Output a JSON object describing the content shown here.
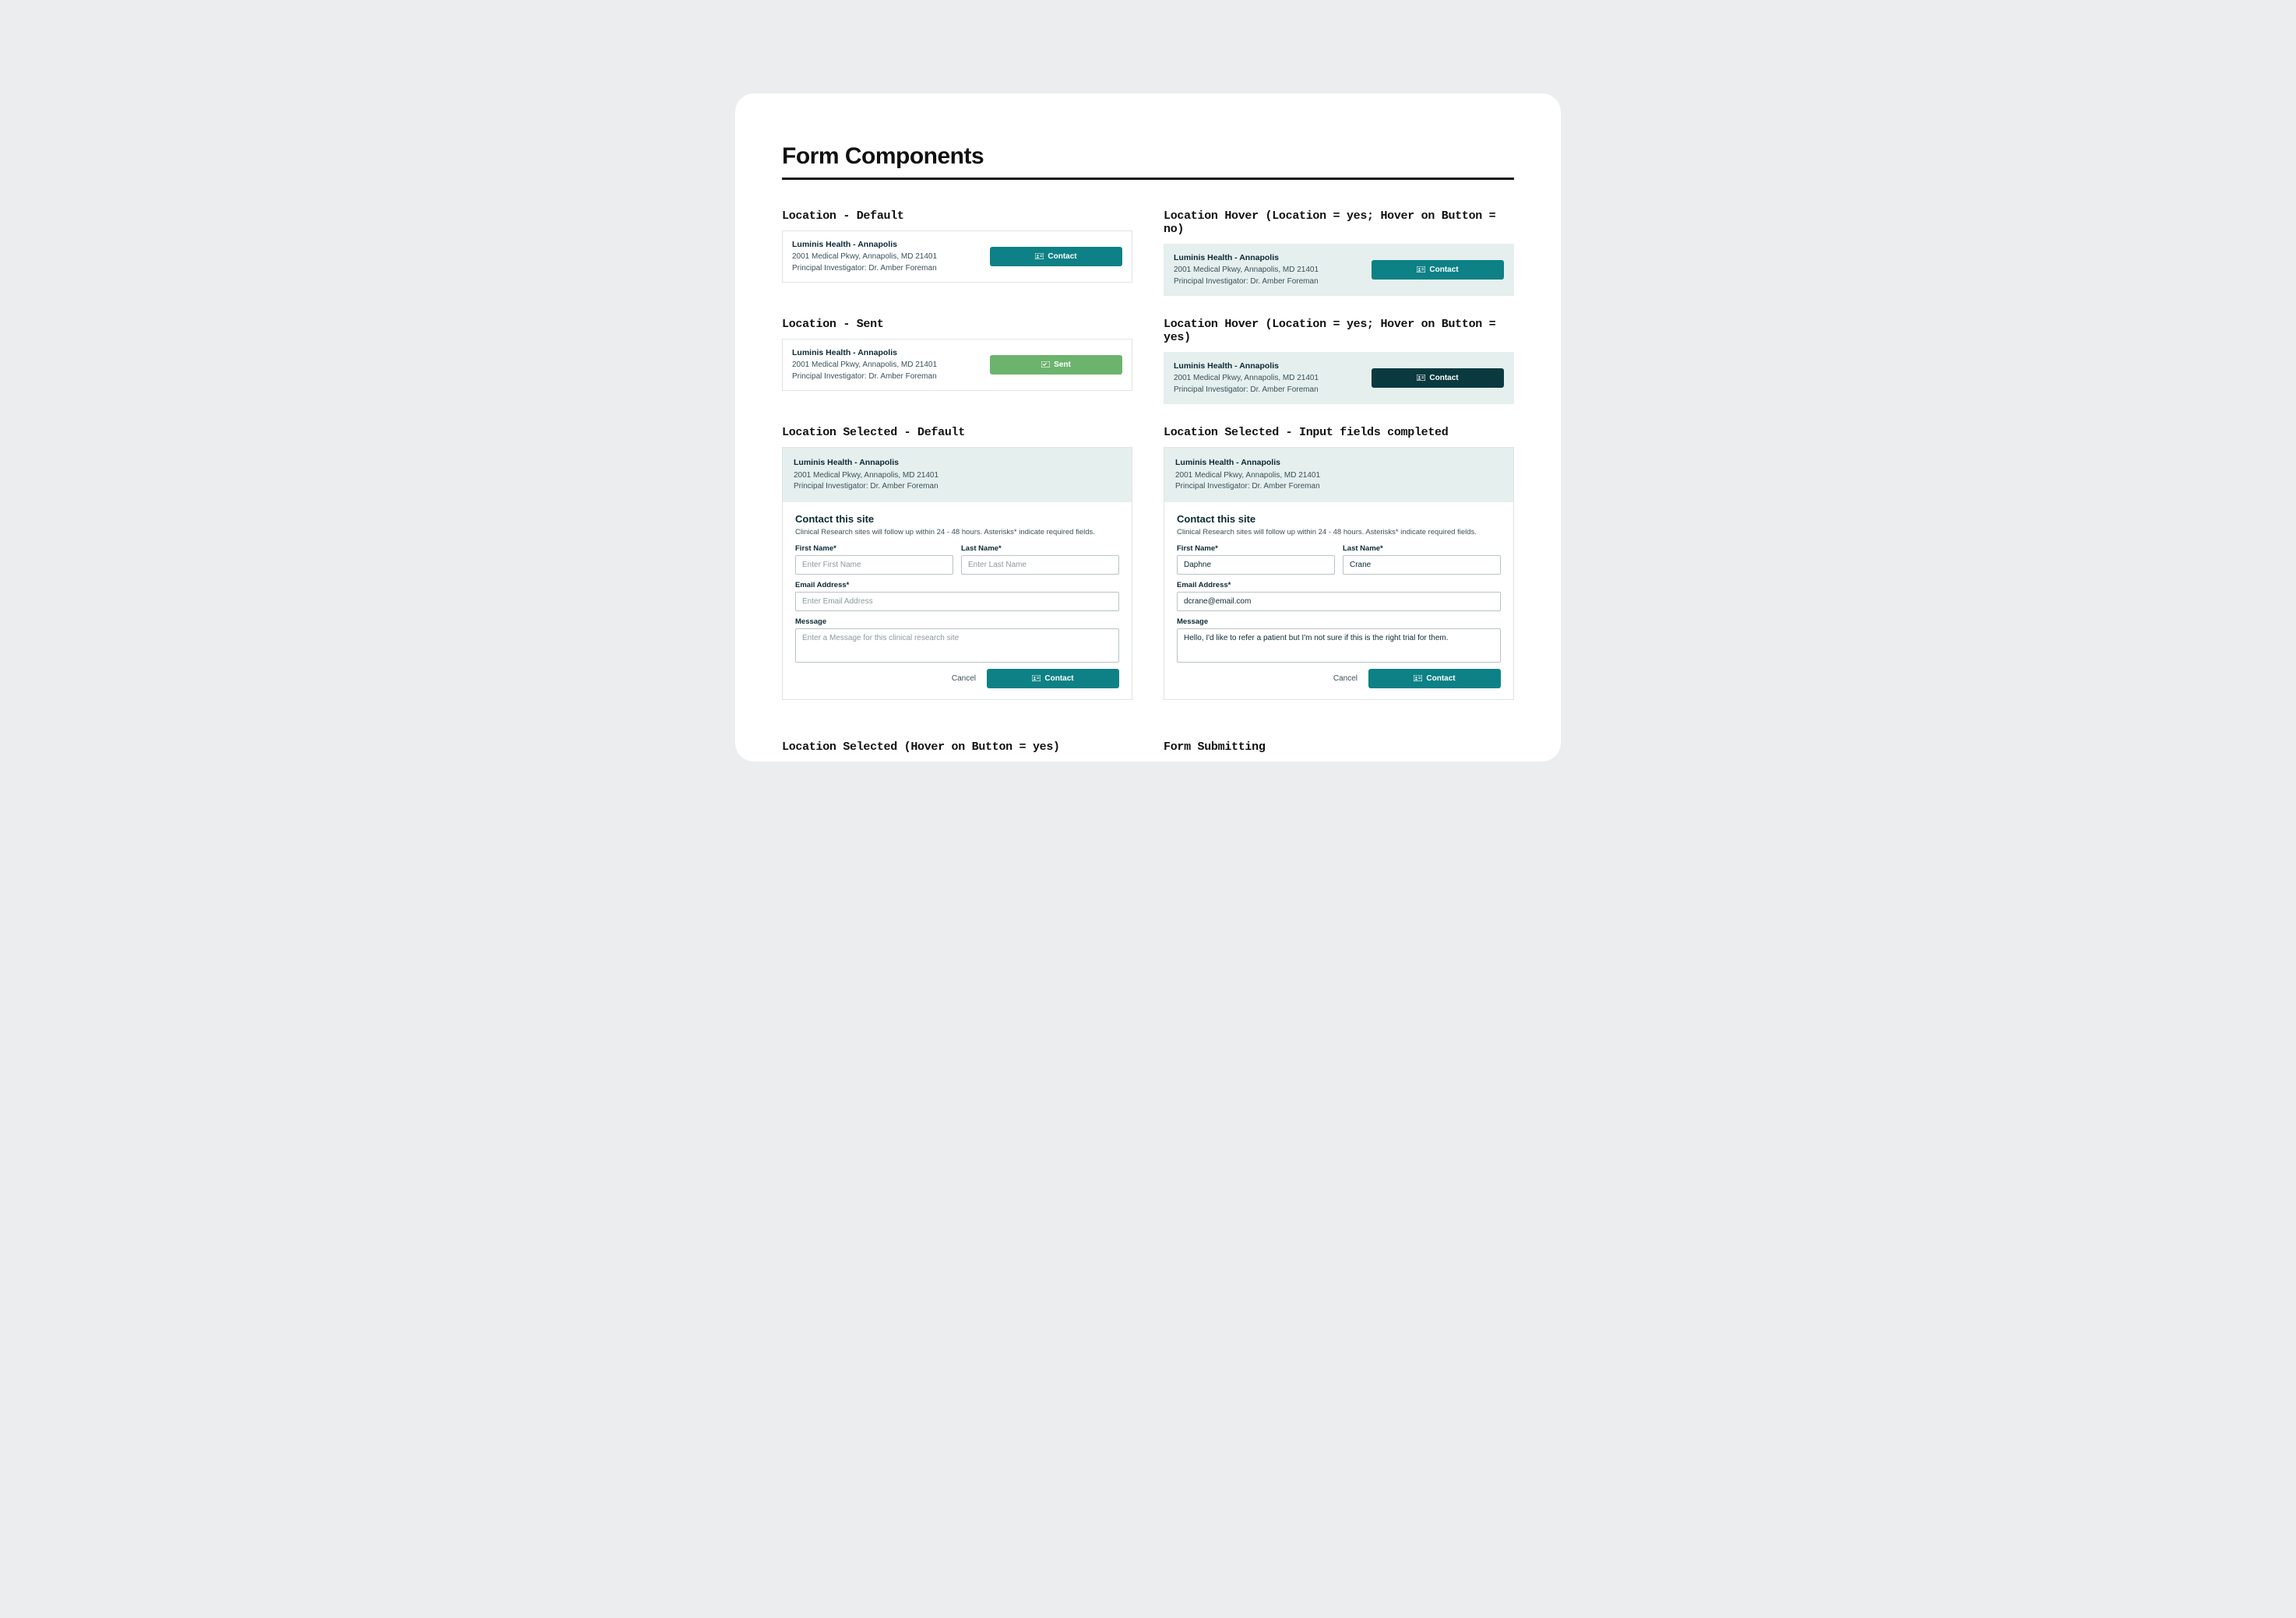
{
  "page": {
    "title": "Form Components"
  },
  "states": {
    "default": "Location - Default",
    "hover_no_btn": "Location Hover (Location = yes; Hover on Button = no)",
    "sent": "Location - Sent",
    "hover_yes_btn": "Location Hover  (Location = yes; Hover on Button = yes)",
    "selected_default": "Location Selected - Default",
    "selected_filled": "Location Selected - Input fields completed",
    "selected_hover_btn": "Location Selected (Hover on Button = yes)",
    "submitting": "Form Submitting"
  },
  "location": {
    "name": "Luminis Health - Annapolis",
    "address": "2001 Medical Pkwy, Annapolis, MD 21401",
    "pi": "Principal Investigator: Dr. Amber Foreman"
  },
  "buttons": {
    "contact": "Contact",
    "sent": "Sent",
    "cancel": "Cancel"
  },
  "form": {
    "title": "Contact this site",
    "sub": "Clinical Research sites will follow up within 24 - 48 hours. Asterisks* indicate required fields.",
    "labels": {
      "first": "First Name*",
      "last": "Last Name*",
      "email": "Email Address*",
      "message": "Message"
    },
    "placeholders": {
      "first": "Enter First Name",
      "last": "Enter Last Name",
      "email": "Enter Email Address",
      "message": "Enter a Message for this clinical research site"
    },
    "filled": {
      "first": "Daphne",
      "last": "Crane",
      "email": "dcrane@email.com",
      "message": "Hello, I'd like to refer a patient but I'm not sure if this is the right trial for them."
    }
  }
}
